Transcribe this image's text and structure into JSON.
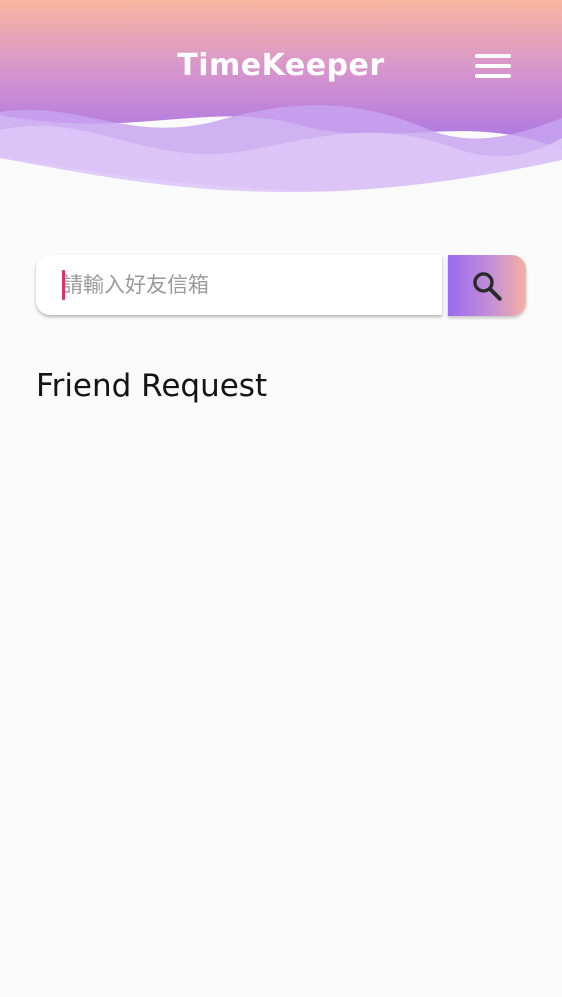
{
  "header": {
    "title": "TimeKeeper",
    "menu_icon": "hamburger-menu-icon",
    "gradient_top": "#f8b3a0",
    "gradient_bottom": "#b07ae6"
  },
  "search": {
    "placeholder": "請輸入好友信箱",
    "value": "",
    "button_icon": "search-icon",
    "caret_color": "#d6336c"
  },
  "friend_requests": {
    "heading": "Friend Request",
    "items": []
  }
}
